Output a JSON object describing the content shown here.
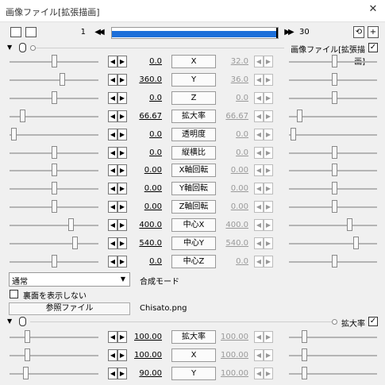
{
  "window": {
    "title": "画像ファイル[拡張描画]",
    "close_glyph": "✕"
  },
  "toolbar": {
    "frame_start": "1",
    "frame_end": "30",
    "progress": 1.0,
    "prev_glyph": "◀◀",
    "next_glyph": "▶▶",
    "plus_glyph": "+"
  },
  "section1": {
    "name": "画像ファイル[拡張描画]",
    "checked_glyph": "✓"
  },
  "rows": [
    {
      "label": "X",
      "left": "0.0",
      "right": "32.0",
      "left_pos": 0.5,
      "right_pos": 0.52
    },
    {
      "label": "Y",
      "left": "360.0",
      "right": "36.0",
      "left_pos": 0.6,
      "right_pos": 0.52
    },
    {
      "label": "Z",
      "left": "0.0",
      "right": "0.0",
      "left_pos": 0.5,
      "right_pos": 0.52
    },
    {
      "label": "拡大率",
      "left": "66.67",
      "right": "66.67",
      "left_pos": 0.12,
      "right_pos": 0.1
    },
    {
      "label": "透明度",
      "left": "0.0",
      "right": "0.0",
      "left_pos": 0.02,
      "right_pos": 0.02
    },
    {
      "label": "縦横比",
      "left": "0.0",
      "right": "0.0",
      "left_pos": 0.5,
      "right_pos": 0.52
    },
    {
      "label": "X軸回転",
      "left": "0.00",
      "right": "0.00",
      "left_pos": 0.5,
      "right_pos": 0.52
    },
    {
      "label": "Y軸回転",
      "left": "0.00",
      "right": "0.00",
      "left_pos": 0.5,
      "right_pos": 0.52
    },
    {
      "label": "Z軸回転",
      "left": "0.00",
      "right": "0.00",
      "left_pos": 0.5,
      "right_pos": 0.52
    },
    {
      "label": "中心X",
      "left": "400.0",
      "right": "400.0",
      "left_pos": 0.7,
      "right_pos": 0.7
    },
    {
      "label": "中心Y",
      "left": "540.0",
      "right": "540.0",
      "left_pos": 0.75,
      "right_pos": 0.78
    },
    {
      "label": "中心Z",
      "left": "0.0",
      "right": "0.0",
      "left_pos": 0.5,
      "right_pos": 0.52
    }
  ],
  "blend": {
    "value": "通常",
    "label": "合成モード",
    "arrow_glyph": "▼"
  },
  "backface": {
    "label": "裏面を表示しない"
  },
  "ref_file": {
    "button": "参照ファイル",
    "filename": "Chisato.png"
  },
  "section2": {
    "name": "拡大率",
    "checked_glyph": "✓"
  },
  "rows2": [
    {
      "label": "拡大率",
      "left": "100.00",
      "right": "100.00",
      "left_pos": 0.18,
      "right_pos": 0.15
    },
    {
      "label": "X",
      "left": "100.00",
      "right": "100.00",
      "left_pos": 0.18,
      "right_pos": 0.15
    },
    {
      "label": "Y",
      "left": "90.00",
      "right": "100.00",
      "left_pos": 0.16,
      "right_pos": 0.15
    }
  ]
}
